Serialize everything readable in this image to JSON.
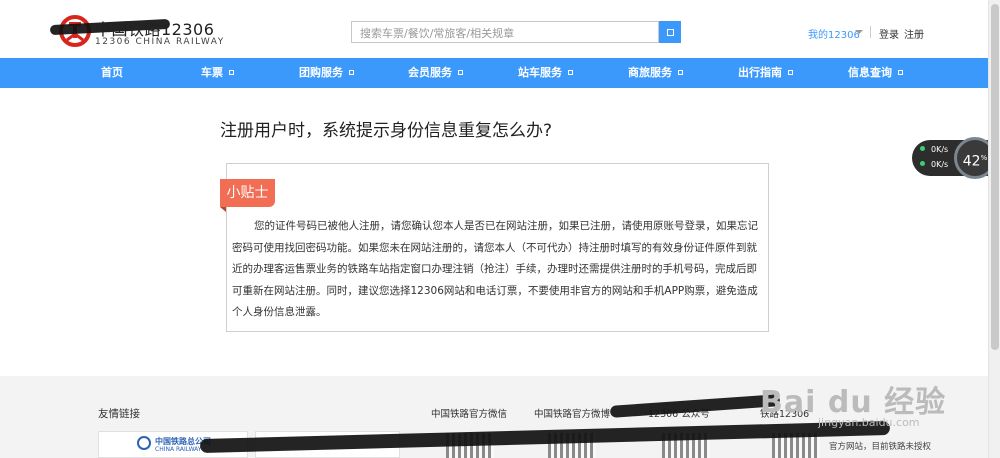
{
  "header": {
    "logo_cn": "中国铁路12306",
    "logo_en": "12306 CHINA RAILWAY",
    "search_placeholder": "搜索车票/餐饮/常旅客/相关规章",
    "my12306": "我的12306",
    "login": "登录",
    "register": "注册"
  },
  "nav": {
    "items": [
      "首页",
      "车票",
      "团购服务",
      "会员服务",
      "站车服务",
      "商旅服务",
      "出行指南",
      "信息查询"
    ]
  },
  "article": {
    "title": "注册用户时，系统提示身份信息重复怎么办?",
    "tip_label": "小贴士",
    "tip_text": "您的证件号码已被他人注册，请您确认您本人是否已在网站注册，如果已注册，请使用原账号登录，如果忘记密码可使用找回密码功能。如果您未在网站注册的，请您本人（不可代办）持注册时填写的有效身份证件原件到就近的办理客运售票业务的铁路车站指定窗口办理注销（抢注）手续，办理时还需提供注册时的手机号码，完成后即可重新在网站注册。同时，建议您选择12306网站和电话订票，不要使用非官方的网站和手机APP购票，避免造成个人身份信息泄露。"
  },
  "widget": {
    "up": "0K/s",
    "down": "0K/s",
    "percent": "42",
    "percent_unit": "%"
  },
  "footer": {
    "links_title": "友情链接",
    "wechat": "中国铁路官方微信",
    "weibo": "中国铁路官方微博",
    "public": "12306 公众号",
    "app": "铁路12306",
    "partner_name": "中国铁路总公司",
    "partner_en": "CHINA RAILWAY",
    "notice": "官方网站，目前铁路未授权"
  },
  "watermark": {
    "text": "Bai du 经验",
    "sub": "jingyan.baidu.com"
  },
  "colors": {
    "nav_bg": "#3b99fc",
    "tip_badge": "#f16e54"
  }
}
